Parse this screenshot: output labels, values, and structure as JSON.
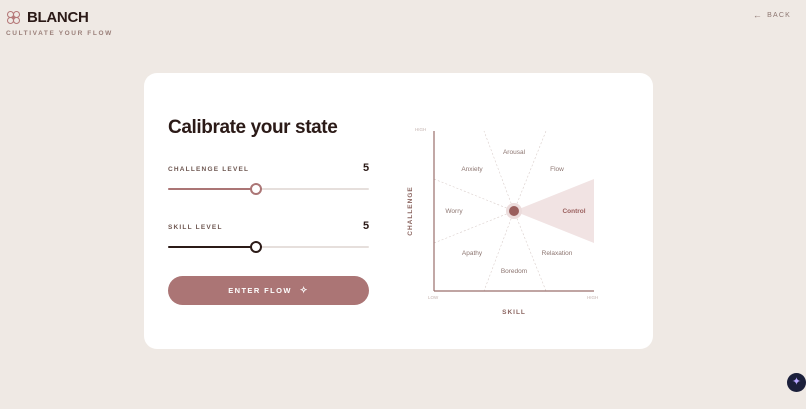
{
  "brand": {
    "name": "BLANCH",
    "tagline": "CULTIVATE YOUR FLOW"
  },
  "nav": {
    "back_label": "BACK",
    "back_icon": "arrow-left-icon"
  },
  "card": {
    "title": "Calibrate your state",
    "challenge": {
      "label": "CHALLENGE LEVEL",
      "value": 5,
      "fraction": 0.44
    },
    "skill": {
      "label": "SKILL LEVEL",
      "value": 5,
      "fraction": 0.44
    },
    "enter_button": {
      "label": "ENTER FLOW",
      "icon": "sparkle-hands-icon"
    }
  },
  "chart_data": {
    "type": "diagram",
    "x_axis": {
      "label": "SKILL",
      "low": "LOW",
      "high": "HIGH"
    },
    "y_axis": {
      "label": "CHALLENGE",
      "high": "HIGH"
    },
    "regions": [
      "Arousal",
      "Anxiety",
      "Flow",
      "Worry",
      "Control",
      "Apathy",
      "Relaxation",
      "Boredom"
    ],
    "active_region": "Control",
    "marker": {
      "skill": 5,
      "challenge": 5
    }
  },
  "colors": {
    "background": "#efe9e4",
    "accent": "#ab7575",
    "dark": "#2b1a17",
    "highlight_fill": "#f1e3e3"
  }
}
